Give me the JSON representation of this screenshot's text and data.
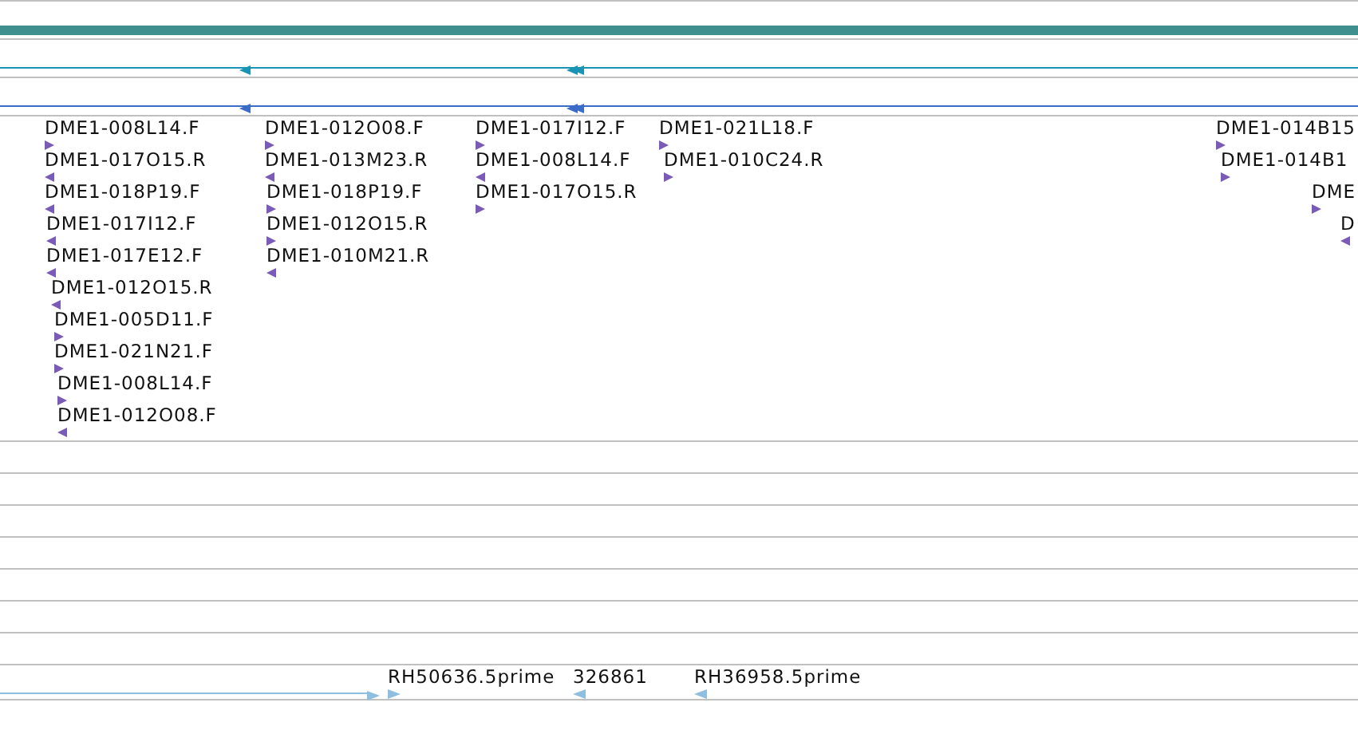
{
  "clone_ends": [
    {
      "label": "DME1-008L14.F",
      "reverse": false
    },
    {
      "label": "DME1-017O15.R",
      "reverse": true
    },
    {
      "label": "DME1-018P19.F",
      "reverse": true
    },
    {
      "label": "DME1-017I12.F",
      "reverse": true
    },
    {
      "label": "DME1-017E12.F",
      "reverse": true
    },
    {
      "label": "DME1-012O15.R",
      "reverse": true
    },
    {
      "label": "DME1-005D11.F",
      "reverse": false
    },
    {
      "label": "DME1-021N21.F",
      "reverse": false
    },
    {
      "label": "DME1-008L14.F",
      "reverse": false
    },
    {
      "label": "DME1-012O08.F",
      "reverse": true
    },
    {
      "label": "DME1-012O08.F",
      "reverse": false
    },
    {
      "label": "DME1-013M23.R",
      "reverse": true
    },
    {
      "label": "DME1-018P19.F",
      "reverse": false
    },
    {
      "label": "DME1-012O15.R",
      "reverse": false
    },
    {
      "label": "DME1-010M21.R",
      "reverse": true
    },
    {
      "label": "DME1-017I12.F",
      "reverse": false
    },
    {
      "label": "DME1-008L14.F",
      "reverse": true
    },
    {
      "label": "DME1-017O15.R",
      "reverse": false
    },
    {
      "label": "DME1-021L18.F",
      "reverse": false
    },
    {
      "label": "DME1-010C24.R",
      "reverse": false
    },
    {
      "label": "DME1-014B15",
      "reverse": false
    },
    {
      "label": "DME1-014B1",
      "reverse": false
    },
    {
      "label": "DME",
      "reverse": false
    },
    {
      "label": "D",
      "reverse": true
    }
  ],
  "est_features": [
    {
      "label": "RH50636.5prime",
      "reverse": false
    },
    {
      "label": "326861",
      "reverse": true
    },
    {
      "label": "RH36958.5prime",
      "reverse": true
    }
  ]
}
